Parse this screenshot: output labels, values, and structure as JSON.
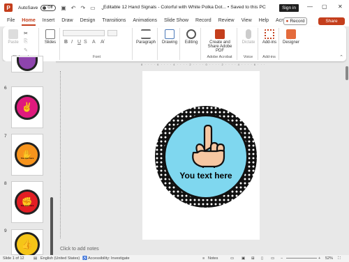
{
  "titlebar": {
    "autosave_label": "AutoSave",
    "toggle_state": "Off",
    "title": "Editable 12 Hand Signals - Colorful with White Polka Dot... • Saved to this PC",
    "signin": "Sign in"
  },
  "menu": {
    "tabs": [
      "File",
      "Home",
      "Insert",
      "Draw",
      "Design",
      "Transitions",
      "Animations",
      "Slide Show",
      "Record",
      "Review",
      "View",
      "Help",
      "Acrobat"
    ],
    "active": "Home",
    "record": "Record",
    "share": "Share"
  },
  "ribbon": {
    "clipboard": {
      "paste": "Paste",
      "label": "Clipboard"
    },
    "slides": {
      "label": "Slides"
    },
    "font": {
      "label": "Font"
    },
    "paragraph": {
      "label": "Paragraph"
    },
    "drawing": {
      "label": "Drawing"
    },
    "editing": {
      "label": "Editing"
    },
    "acrobat": {
      "button": "Create and Share Adobe PDF",
      "label": "Adobe Acrobat"
    },
    "voice": {
      "button": "Dictate",
      "label": "Voice"
    },
    "addins": {
      "button": "Add-ins",
      "label": "Add-ins"
    },
    "designer": {
      "button": "Designer"
    }
  },
  "thumbnails": [
    {
      "num": "6",
      "color": "#e0197d",
      "icon": "✌"
    },
    {
      "num": "7",
      "color": "#f7941d",
      "icon": "✋"
    },
    {
      "num": "8",
      "color": "#e31e24",
      "icon": "✊"
    },
    {
      "num": "9",
      "color": "#f5c518",
      "icon": "👍"
    }
  ],
  "thumb_text": "You text here",
  "slide": {
    "caption": "You text here",
    "inner_color": "#7fd7ef"
  },
  "notes_placeholder": "Click to add notes",
  "status": {
    "slide": "Slide 1 of 12",
    "language": "English (United States)",
    "accessibility": "Accessibility: Investigate",
    "notes": "Notes",
    "zoom": "52%"
  },
  "ruler_text": "8 · · · · 6 · · · · 4 · · · · 2 · · · · 0 · · · · 2 · · · · 4 · · · · 6 · · · · 8"
}
